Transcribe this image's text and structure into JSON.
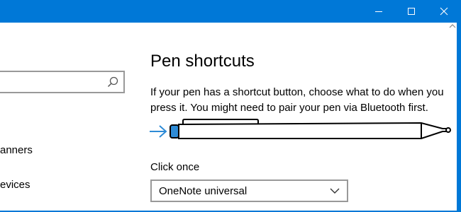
{
  "window": {
    "controls": {
      "minimize_icon": "minimize-icon",
      "maximize_icon": "maximize-icon",
      "close_icon": "close-icon"
    },
    "accent_color": "#0078d7"
  },
  "sidebar": {
    "search": {
      "placeholder": "",
      "icon": "search-icon"
    },
    "items": [
      {
        "label": "anners"
      },
      {
        "label": "evices"
      }
    ]
  },
  "main": {
    "title": "Pen shortcuts",
    "description": "If your pen has a shortcut button, choose what to do when you press it. You might need to pair your pen via Bluetooth first.",
    "illustration": {
      "icon": "pen-icon",
      "pointer_icon": "arrow-right-icon",
      "highlight_color": "#2e8bd6"
    },
    "click_once": {
      "label": "Click once",
      "selected": "OneNote universal"
    }
  }
}
